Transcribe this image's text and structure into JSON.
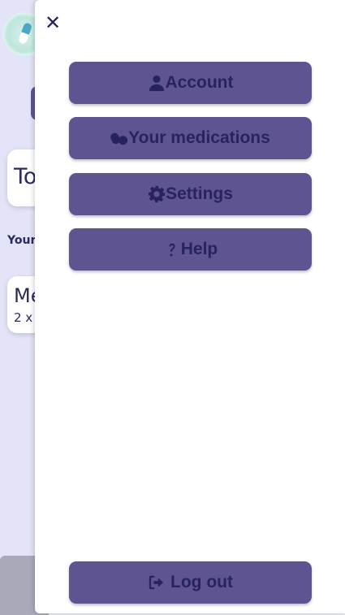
{
  "background": {
    "today_card_text": "To",
    "section_label": "Your",
    "med_card_title": "Me",
    "med_card_sub": "2 x"
  },
  "drawer": {
    "close_symbol": "✕",
    "menu": [
      {
        "label": "Account",
        "icon": "user-icon"
      },
      {
        "label": "Your medications",
        "icon": "pills-icon"
      },
      {
        "label": "Settings",
        "icon": "gear-icon"
      },
      {
        "label": "Help",
        "icon": "question-icon"
      }
    ],
    "logout": {
      "label": "Log out",
      "icon": "logout-icon"
    }
  },
  "colors": {
    "button_bg": "#5e5491",
    "button_text": "#27235f",
    "page_bg": "#e3e4f7",
    "drawer_bg": "#ffffff"
  }
}
